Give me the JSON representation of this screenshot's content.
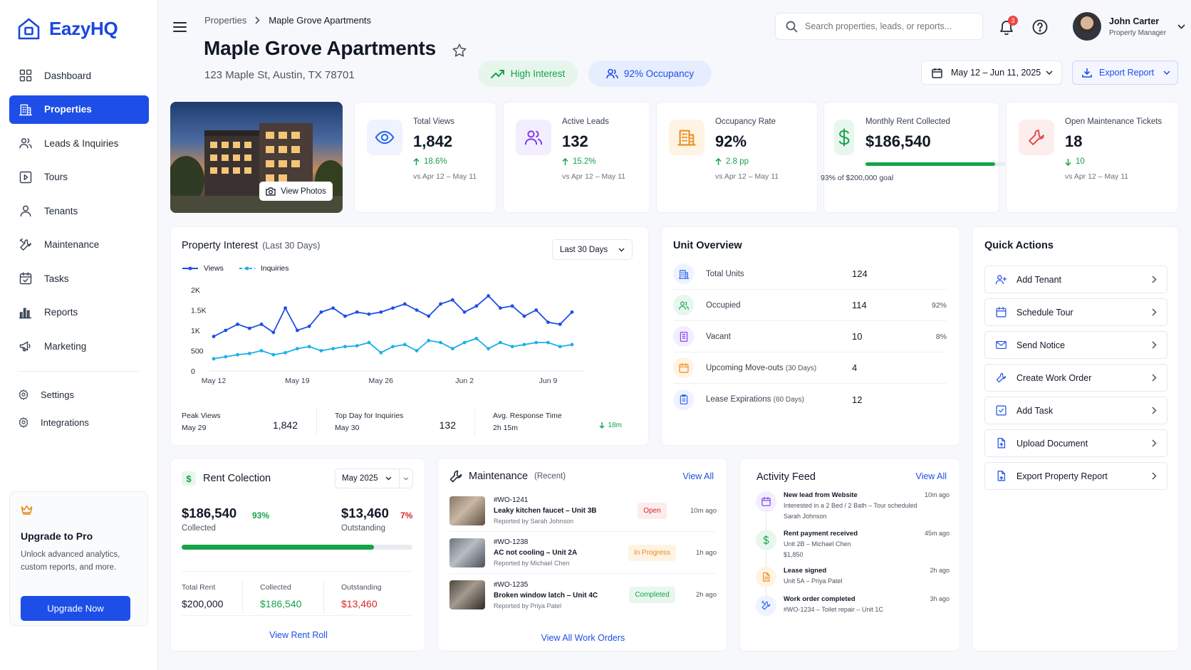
{
  "app": {
    "name": "EazyHQ"
  },
  "nav": {
    "items": [
      {
        "label": "Dashboard",
        "icon": "dashboard-icon"
      },
      {
        "label": "Properties",
        "icon": "building-icon",
        "active": true
      },
      {
        "label": "Leads & Inquiries",
        "icon": "users-icon"
      },
      {
        "label": "Tours",
        "icon": "play-square-icon"
      },
      {
        "label": "Tenants",
        "icon": "user-icon"
      },
      {
        "label": "Maintenance",
        "icon": "tools-icon"
      },
      {
        "label": "Tasks",
        "icon": "calendar-check-icon"
      },
      {
        "label": "Reports",
        "icon": "bar-chart-icon"
      },
      {
        "label": "Marketing",
        "icon": "megaphone-icon"
      }
    ],
    "secondary": [
      {
        "label": "Settings",
        "icon": "gear-icon"
      },
      {
        "label": "Integrations",
        "icon": "integration-icon"
      }
    ]
  },
  "upgrade": {
    "title": "Upgrade to Pro",
    "text": "Unlock advanced analytics, custom reports, and more.",
    "button": "Upgrade Now"
  },
  "header": {
    "breadcrumb": [
      "Properties",
      "Maple Grove Apartments"
    ],
    "title": "Maple Grove Apartments",
    "address": "123 Maple St, Austin, TX 78701",
    "badges": [
      "High Interest",
      "92% Occupancy"
    ],
    "search_placeholder": "Search properties, leads, or reports...",
    "notification_count": "3",
    "user": {
      "name": "John Carter",
      "role": "Property Manager"
    },
    "date_range": "May 12 – Jun 11, 2025",
    "export": "Export Report"
  },
  "photo": {
    "button": "View Photos"
  },
  "kpis": [
    {
      "label": "Total Views",
      "value": "1,842",
      "change": "18.6%",
      "compare": "vs Apr 12 – May 11",
      "color": "#2563eb",
      "bg": "#eef3ff",
      "icon": "eye-icon"
    },
    {
      "label": "Active Leads",
      "value": "132",
      "change": "15.2%",
      "compare": "vs Apr 12 – May 11",
      "color": "#7c3aed",
      "bg": "#f3eefe",
      "icon": "users-icon"
    },
    {
      "label": "Occupancy Rate",
      "value": "92%",
      "change": "2.8 pp",
      "compare": "vs Apr 12 – May 11",
      "color": "#ea8a1a",
      "bg": "#fff3e4",
      "icon": "building-icon"
    },
    {
      "label": "Monthly Rent Collected",
      "value": "$186,540",
      "goal_text": "93% of $200,000 goal",
      "progress": 0.93,
      "color": "#16a34a",
      "bg": "#e8f7ee",
      "icon": "dollar-icon"
    },
    {
      "label": "Open Maintenance Tickets",
      "value": "18",
      "change": "10",
      "compare": "vs Apr 12 – May 11",
      "color": "#e5484d",
      "bg": "#fdeeee",
      "icon": "wrench-icon"
    }
  ],
  "interest": {
    "title": "Property Interest",
    "subtitle": "(Last 30 Days)",
    "range": "Last 30 Days",
    "stats": [
      {
        "label": "Peak Views",
        "sub": "May 29",
        "value": "1,842"
      },
      {
        "label": "Top Day for Inquiries",
        "sub": "May 30",
        "value": "132"
      },
      {
        "label": "Avg. Response Time",
        "sub": "2h 15m",
        "value": "18m"
      }
    ]
  },
  "chart_data": {
    "type": "line",
    "x": [
      "May 12",
      "May 13",
      "May 14",
      "May 15",
      "May 16",
      "May 17",
      "May 18",
      "May 19",
      "May 20",
      "May 21",
      "May 22",
      "May 23",
      "May 24",
      "May 25",
      "May 26",
      "May 27",
      "May 28",
      "May 29",
      "May 30",
      "May 31",
      "Jun 1",
      "Jun 2",
      "Jun 3",
      "Jun 4",
      "Jun 5",
      "Jun 6",
      "Jun 7",
      "Jun 8",
      "Jun 9",
      "Jun 10",
      "Jun 11"
    ],
    "series": [
      {
        "name": "Views",
        "color": "#1e4ee8",
        "values": [
          850,
          1000,
          1150,
          1050,
          1150,
          950,
          1550,
          1000,
          1100,
          1450,
          1550,
          1350,
          1450,
          1400,
          1450,
          1550,
          1650,
          1500,
          1350,
          1650,
          1750,
          1450,
          1600,
          1850,
          1550,
          1600,
          1350,
          1500,
          1200,
          1150,
          1450
        ]
      },
      {
        "name": "Inquiries",
        "color": "#1ab0e8",
        "values": [
          300,
          350,
          400,
          430,
          500,
          400,
          450,
          550,
          600,
          500,
          550,
          600,
          620,
          700,
          450,
          600,
          650,
          500,
          750,
          700,
          550,
          700,
          800,
          550,
          700,
          600,
          650,
          700,
          700,
          600,
          650
        ]
      }
    ],
    "x_ticks": [
      "May 12",
      "May 19",
      "May 26",
      "Jun 2",
      "Jun 9"
    ],
    "y_ticks": [
      "0",
      "500",
      "1K",
      "1.5K",
      "2K"
    ],
    "ylim": [
      0,
      2000
    ]
  },
  "units": {
    "title": "Unit Overview",
    "rows": [
      {
        "label": "Total Units",
        "note": "",
        "value": "124",
        "pct": "",
        "color": "#2563eb",
        "bg": "#eef3ff",
        "icon": "building-icon"
      },
      {
        "label": "Occupied",
        "note": "",
        "value": "114",
        "pct": "92%",
        "color": "#16a34a",
        "bg": "#e8f7ee",
        "icon": "users-icon"
      },
      {
        "label": "Vacant",
        "note": "",
        "value": "10",
        "pct": "8%",
        "color": "#7c3aed",
        "bg": "#f3eefe",
        "icon": "door-icon"
      },
      {
        "label": "Upcoming Move-outs",
        "note": "(30 Days)",
        "value": "4",
        "pct": "",
        "color": "#ea8a1a",
        "bg": "#fff3e4",
        "icon": "calendar-icon"
      },
      {
        "label": "Lease Expirations",
        "note": "(60 Days)",
        "value": "12",
        "pct": "",
        "color": "#2563eb",
        "bg": "#eef3ff",
        "icon": "clipboard-icon"
      }
    ]
  },
  "quick": {
    "title": "Quick Actions",
    "items": [
      {
        "label": "Add Tenant",
        "icon": "user-plus-icon"
      },
      {
        "label": "Schedule Tour",
        "icon": "calendar-icon"
      },
      {
        "label": "Send Notice",
        "icon": "mail-icon"
      },
      {
        "label": "Create Work Order",
        "icon": "wrench-icon"
      },
      {
        "label": "Add Task",
        "icon": "check-square-icon"
      },
      {
        "label": "Upload Document",
        "icon": "document-upload-icon"
      },
      {
        "label": "Export Property Report",
        "icon": "export-icon"
      }
    ]
  },
  "rent": {
    "title": "Rent Colection",
    "month": "May 2025",
    "collected": "$186,540",
    "collected_label": "Collected",
    "collected_pct": "93%",
    "outstanding": "$13,460",
    "outstanding_label": "Outstanding",
    "outstanding_pct": "7%",
    "progress": 0.93,
    "totals": [
      {
        "label": "Total Rent",
        "value": "$200,000",
        "color": "#111827"
      },
      {
        "label": "Collected",
        "value": "$186,540",
        "color": "#16a34a"
      },
      {
        "label": "Outstanding",
        "value": "$13,460",
        "color": "#dc2626"
      }
    ],
    "link": "View Rent Roll"
  },
  "maint": {
    "title": "Maintenance",
    "sub": "(Recent)",
    "view_all": "View All",
    "link": "View All Work Orders",
    "items": [
      {
        "id": "#WO-1241",
        "title": "Leaky kitchen faucet – Unit 3B",
        "by": "Reported by Sarah Johnson",
        "status": "Open",
        "time": "10m ago",
        "fg": "#dc2626",
        "bg": "#fdecec"
      },
      {
        "id": "#WO-1238",
        "title": "AC not cooling – Unit 2A",
        "by": "Reported by Michael Chen",
        "status": "In Progress",
        "time": "1h ago",
        "fg": "#ea8a1a",
        "bg": "#fff3e4"
      },
      {
        "id": "#WO-1235",
        "title": "Broken window latch – Unit 4C",
        "by": "Reported by Priya Patel",
        "status": "Completed",
        "time": "2h ago",
        "fg": "#16a34a",
        "bg": "#e8f7ee"
      }
    ]
  },
  "activity": {
    "title": "Activity Feed",
    "view_all": "View All",
    "items": [
      {
        "title": "New lead from Website",
        "l1": "Interested in a 2 Bed / 2 Bath – Tour scheduled",
        "l2": "Sarah Johnson",
        "time": "10m ago",
        "color": "#7c3aed",
        "bg": "#f3eefe",
        "icon": "calendar-icon"
      },
      {
        "title": "Rent payment received",
        "l1": "Unit 2B – Michael Chen",
        "l2": "$1,850",
        "time": "45m ago",
        "color": "#16a34a",
        "bg": "#e8f7ee",
        "icon": "dollar-icon"
      },
      {
        "title": "Lease signed",
        "l1": "Unit 5A – Priya Patel",
        "l2": "",
        "time": "2h ago",
        "color": "#ea8a1a",
        "bg": "#fff3e4",
        "icon": "document-icon"
      },
      {
        "title": "Work order completed",
        "l1": "#WO-1234 – Toilet repair – Unit 1C",
        "l2": "",
        "time": "3h ago",
        "color": "#2563eb",
        "bg": "#eef3ff",
        "icon": "tools-icon"
      }
    ]
  }
}
